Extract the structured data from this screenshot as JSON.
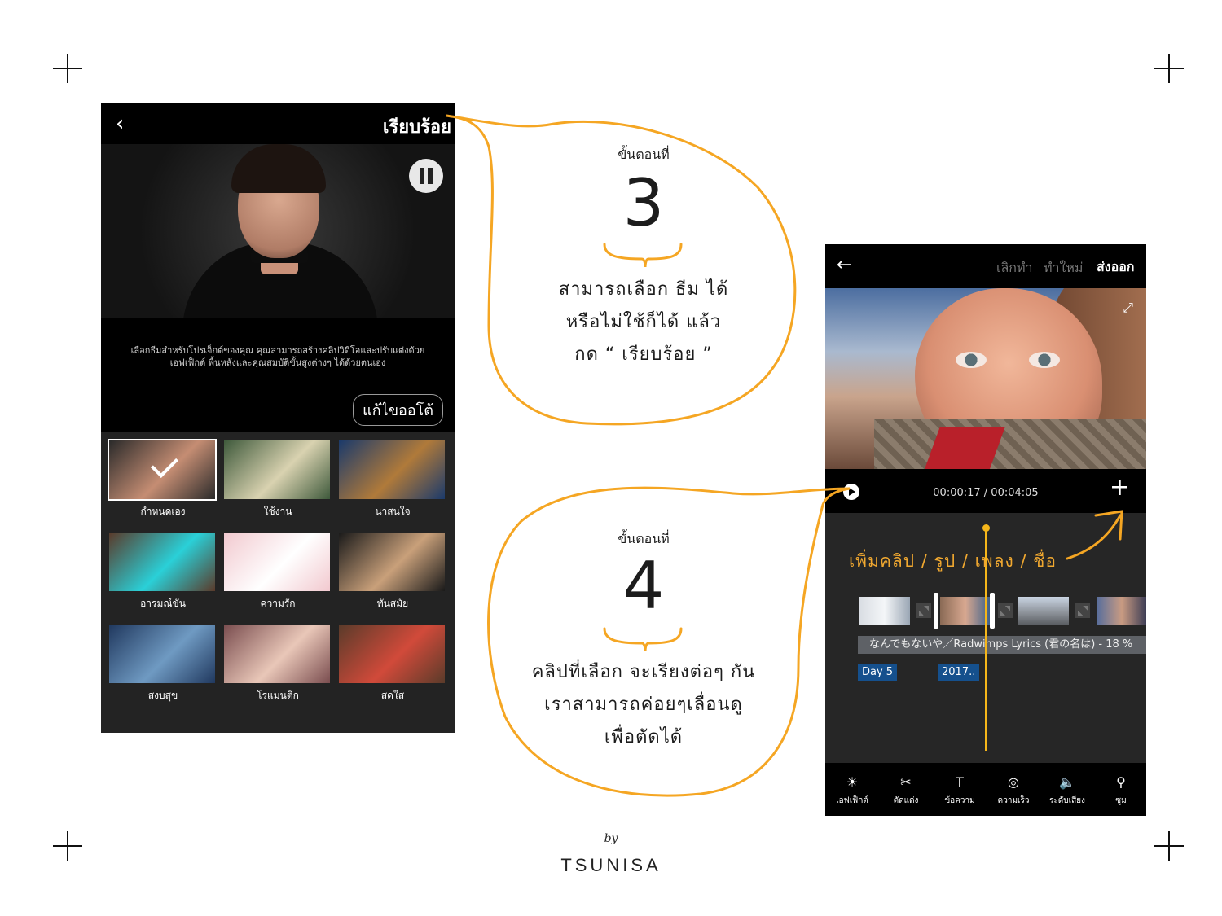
{
  "theme": {
    "accent": "#f5a623",
    "dark_bg": "#000000",
    "panel_bg": "#232323",
    "tag_blue": "#15508d"
  },
  "left_screen": {
    "back_icon": "chevron-left-icon",
    "done_label": "เรียบร้อย",
    "description": "เลือกธีมสำหรับโปรเจ็กต์ของคุณ คุณสามารถสร้างคลิปวิดีโอและปรับแต่งด้วย เอฟเฟ็กต์ พื้นหลังและคุณสมบัติขั้นสูงต่างๆ ได้ด้วยตนเอง",
    "auto_edit_label": "แก้ไขออโต้",
    "themes": [
      {
        "label": "กำหนดเอง",
        "colors": [
          "#2a2a2a",
          "#c58d73"
        ],
        "selected": true
      },
      {
        "label": "ใช้งาน",
        "colors": [
          "#3f5a3c",
          "#d9d2b0"
        ],
        "selected": false
      },
      {
        "label": "น่าสนใจ",
        "colors": [
          "#1b3a6b",
          "#b07a3a"
        ],
        "selected": false
      },
      {
        "label": "อารมณ์ขัน",
        "colors": [
          "#5a3a2a",
          "#2ad0d8"
        ],
        "selected": false
      },
      {
        "label": "ความรัก",
        "colors": [
          "#f2c9cf",
          "#ffffff"
        ],
        "selected": false
      },
      {
        "label": "ทันสมัย",
        "colors": [
          "#1a1a1a",
          "#c9a07a"
        ],
        "selected": false
      },
      {
        "label": "สงบสุข",
        "colors": [
          "#20385e",
          "#6f9ac2"
        ],
        "selected": false
      },
      {
        "label": "โรแมนติก",
        "colors": [
          "#7a4d4f",
          "#e9c7b8"
        ],
        "selected": false
      },
      {
        "label": "สดใส",
        "colors": [
          "#5a3b2a",
          "#d14a3a"
        ],
        "selected": false
      }
    ]
  },
  "right_screen": {
    "back_icon": "arrow-left-icon",
    "cancel_label": "เลิกทำ",
    "redo_label": "ทำใหม่",
    "export_label": "ส่งออก",
    "time_display": "00:00:17 / 00:04:05",
    "music_track": "なんでもないや／Radwimps Lyrics (君の名は) - 18 %",
    "tags": [
      "Day 5",
      "2017.."
    ],
    "tools": [
      {
        "icon": "effects-icon",
        "glyph": "☀",
        "label": "เอฟเฟ็กต์"
      },
      {
        "icon": "scissors-icon",
        "glyph": "✂",
        "label": "ตัดแต่ง"
      },
      {
        "icon": "text-icon",
        "glyph": "T",
        "label": "ข้อความ"
      },
      {
        "icon": "speed-icon",
        "glyph": "◎",
        "label": "ความเร็ว"
      },
      {
        "icon": "volume-icon",
        "glyph": "🔈",
        "label": "ระดับเสียง"
      },
      {
        "icon": "zoom-icon",
        "glyph": "⚲",
        "label": "ซูม"
      }
    ]
  },
  "annotations": {
    "step3": {
      "step_label": "ขั้นตอนที่",
      "number": "3",
      "lines": [
        "สามารถเลือก ธีม ได้",
        "หรือไม่ใช้ก็ได้ แล้ว",
        "กด “ เรียบร้อย ”"
      ]
    },
    "step4": {
      "step_label": "ขั้นตอนที่",
      "number": "4",
      "lines": [
        "คลิปที่เลือก จะเรียงต่อๆ กัน",
        "เราสามารถค่อยๆเลื่อนดู",
        "เพื่อตัดได้"
      ]
    },
    "add_hint": "เพิ่มคลิป / รูป / เพลง / ชื่อ"
  },
  "signature": {
    "by": "by",
    "name": "TSUNISA"
  }
}
